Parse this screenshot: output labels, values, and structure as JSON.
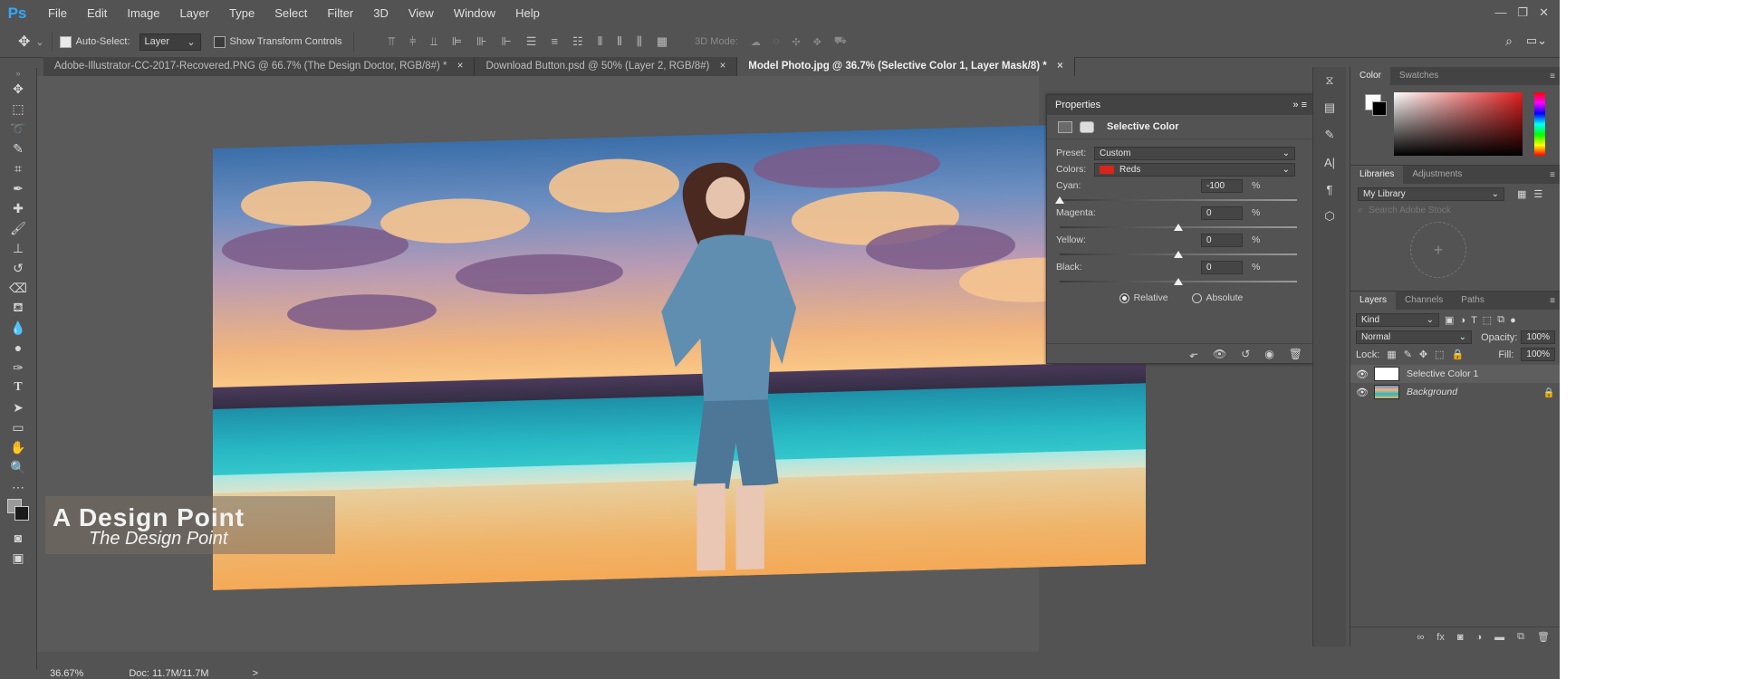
{
  "app": {
    "logo": "Ps"
  },
  "menu": [
    "File",
    "Edit",
    "Image",
    "Layer",
    "Type",
    "Select",
    "Filter",
    "3D",
    "View",
    "Window",
    "Help"
  ],
  "window_controls": [
    "—",
    "❐",
    "✕"
  ],
  "options": {
    "auto_select_label": "Auto-Select:",
    "auto_select_value": "Layer",
    "show_transform_label": "Show Transform Controls",
    "mode_3d_label": "3D Mode:"
  },
  "tabs": [
    {
      "label": "Adobe-Illustrator-CC-2017-Recovered.PNG @ 66.7% (The Design Doctor, RGB/8#) *",
      "close": "×"
    },
    {
      "label": "Download Button.psd @ 50% (Layer 2, RGB/8#)",
      "close": "×"
    },
    {
      "label": "Model Photo.jpg @ 36.7% (Selective Color 1, Layer Mask/8) *",
      "close": "×"
    }
  ],
  "watermark": {
    "line1": "A Design Point",
    "line2": "The Design Point"
  },
  "status": {
    "zoom": "36.67%",
    "doc": "Doc: 11.7M/11.7M",
    "arrow": ">"
  },
  "properties": {
    "panel_title": "Properties",
    "adjustment_title": "Selective Color",
    "preset_label": "Preset:",
    "preset_value": "Custom",
    "colors_label": "Colors:",
    "colors_value": "Reds",
    "sliders": [
      {
        "label": "Cyan:",
        "value": "-100",
        "unit": "%",
        "level": 0.0
      },
      {
        "label": "Magenta:",
        "value": "0",
        "unit": "%",
        "level": 0.5
      },
      {
        "label": "Yellow:",
        "value": "0",
        "unit": "%",
        "level": 0.5
      },
      {
        "label": "Black:",
        "value": "0",
        "unit": "%",
        "level": 0.5
      }
    ],
    "relative_label": "Relative",
    "absolute_label": "Absolute",
    "mode": "Relative"
  },
  "color_panel": {
    "tabs": [
      "Color",
      "Swatches"
    ]
  },
  "libraries_panel": {
    "tabs": [
      "Libraries",
      "Adjustments"
    ],
    "library": "My Library",
    "search_placeholder": "Search Adobe Stock"
  },
  "layers_panel": {
    "tabs": [
      "Layers",
      "Channels",
      "Paths"
    ],
    "kind": "Kind",
    "blend_mode": "Normal",
    "opacity_label": "Opacity:",
    "opacity_value": "100%",
    "lock_label": "Lock:",
    "fill_label": "Fill:",
    "fill_value": "100%",
    "layers": [
      {
        "name": "Selective Color 1",
        "selected": true
      },
      {
        "name": "Background",
        "selected": false
      }
    ],
    "footer_icons": [
      "link-icon",
      "fx-icon",
      "mask-icon",
      "adjustment-icon",
      "folder-icon",
      "new-layer-icon",
      "trash-icon"
    ]
  },
  "colors": {
    "accent": "#31a8ff",
    "red_swatch": "#e01f1f"
  }
}
